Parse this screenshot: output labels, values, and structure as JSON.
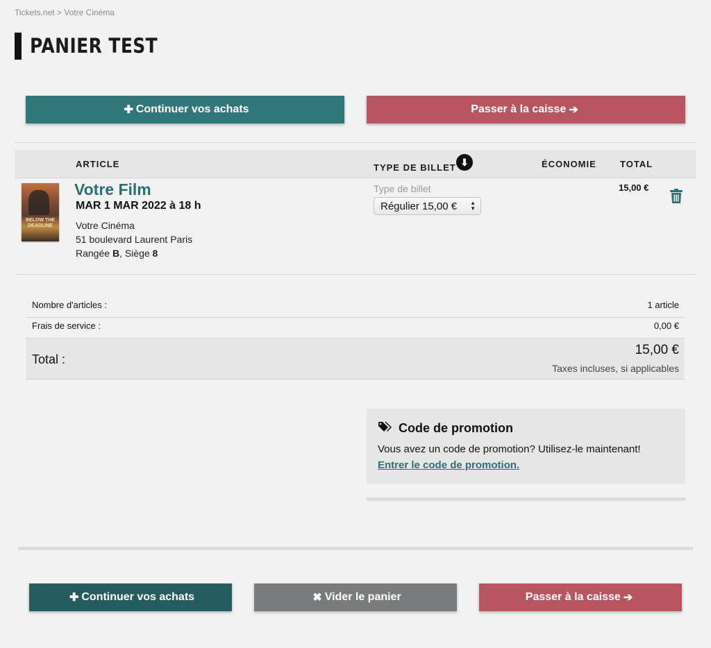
{
  "breadcrumb": "Tickets.net > Votre Cinéma",
  "page_title": "PANIER TEST",
  "top_buttons": {
    "continue_label": "Continuer vos achats",
    "checkout_label": "Passer à la caisse"
  },
  "table": {
    "headers": {
      "article": "ARTICLE",
      "ticket_type": "TYPE DE BILLET",
      "savings": "ÉCONOMIE",
      "total": "TOTAL"
    }
  },
  "item": {
    "film_title": "Votre Film",
    "date": "MAR 1 MAR 2022 à 18 h",
    "cinema": "Votre Cinéma",
    "address": "51 boulevard Laurent Paris",
    "row_prefix": "Rangée",
    "row": "B",
    "seat_prefix": ", Siège",
    "seat": "8",
    "ticket_type_label": "Type de billet",
    "ticket_type_selected": "Régulier 15,00 €",
    "total": "15,00 €",
    "poster_text": "BELOW THE DEADLINE"
  },
  "summary": {
    "count_label": "Nombre d'articles :",
    "count_value": "1 article",
    "fees_label": "Frais de service :",
    "fees_value": "0,00 €",
    "total_label": "Total :",
    "total_value": "15,00 €",
    "tax_note": "Taxes incluses, si applicables"
  },
  "promo": {
    "title": "Code de promotion",
    "text": "Vous avez un code de promotion? Utilisez-le maintenant!",
    "link": "Entrer le code de promotion."
  },
  "bottom_buttons": {
    "continue_label": "Continuer vos achats",
    "clear_label": "Vider le panier",
    "checkout_label": "Passer à la caisse"
  },
  "colors": {
    "teal": "#31767b",
    "dark_teal": "#245c5f",
    "red": "#b75661",
    "grey": "#7a7b7c",
    "link": "#2b6f76"
  }
}
